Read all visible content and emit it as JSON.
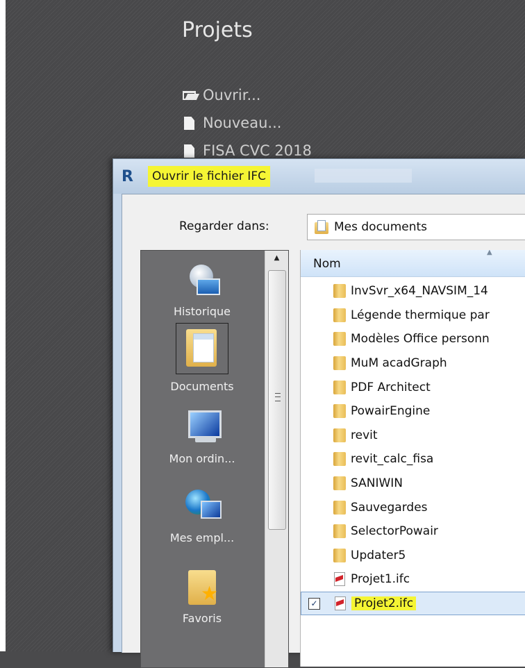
{
  "background_app": {
    "section_title": "Projets",
    "items": [
      {
        "label": "Ouvrir...",
        "icon": "open-folder-icon"
      },
      {
        "label": "Nouveau...",
        "icon": "page-icon"
      },
      {
        "label": "FISA CVC 2018",
        "icon": "page-icon"
      }
    ]
  },
  "dialog": {
    "app_icon_letter": "R",
    "title": "Ouvrir le fichier IFC",
    "look_in_label": "Regarder dans:",
    "look_in_value": "Mes documents",
    "places": [
      {
        "label": "Historique",
        "icon": "history-icon"
      },
      {
        "label": "Documents",
        "icon": "documents-icon"
      },
      {
        "label": "Mon ordin...",
        "icon": "computer-icon"
      },
      {
        "label": "Mes empl...",
        "icon": "network-places-icon"
      },
      {
        "label": "Favoris",
        "icon": "favorites-icon"
      }
    ],
    "column_header": "Nom",
    "files": [
      {
        "name": "InvSvr_x64_NAVSIM_14",
        "type": "folder"
      },
      {
        "name": "Légende thermique par",
        "type": "folder"
      },
      {
        "name": "Modèles Office personn",
        "type": "folder"
      },
      {
        "name": "MuM acadGraph",
        "type": "folder"
      },
      {
        "name": "PDF Architect",
        "type": "folder"
      },
      {
        "name": "PowairEngine",
        "type": "folder"
      },
      {
        "name": "revit",
        "type": "folder"
      },
      {
        "name": "revit_calc_fisa",
        "type": "folder"
      },
      {
        "name": "SANIWIN",
        "type": "folder"
      },
      {
        "name": "Sauvegardes",
        "type": "folder"
      },
      {
        "name": "SelectorPowair",
        "type": "folder"
      },
      {
        "name": "Updater5",
        "type": "folder"
      },
      {
        "name": "Projet1.ifc",
        "type": "ifc"
      },
      {
        "name": "Projet2.ifc",
        "type": "ifc",
        "selected": true,
        "checked": true,
        "check_mark": "✓"
      }
    ],
    "highlight_color": "#f5f534"
  }
}
